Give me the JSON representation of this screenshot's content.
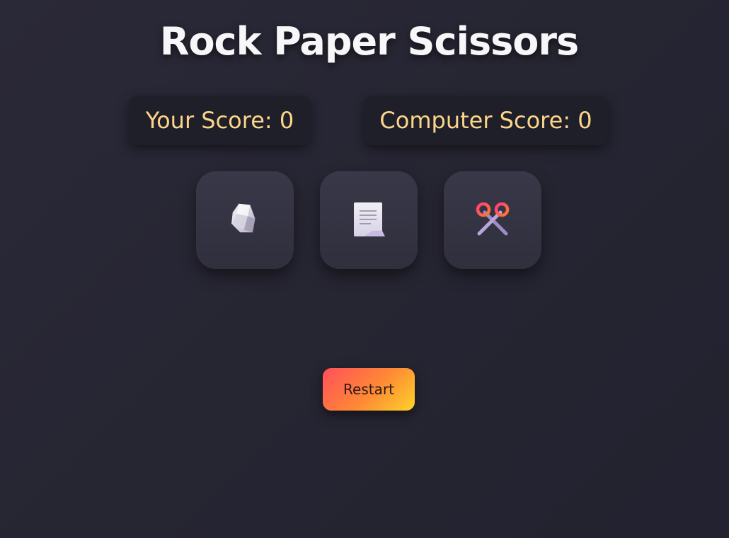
{
  "game": {
    "title": "Rock Paper Scissors"
  },
  "scores": {
    "player_label": "Your Score: 0",
    "player_value": 0,
    "computer_label": "Computer Score: 0",
    "computer_value": 0
  },
  "choices": [
    {
      "id": "rock",
      "icon": "rock-icon"
    },
    {
      "id": "paper",
      "icon": "paper-icon"
    },
    {
      "id": "scissors",
      "icon": "scissors-icon"
    }
  ],
  "controls": {
    "restart_label": "Restart"
  },
  "colors": {
    "background": "#262532",
    "title": "#f7f7f9",
    "score_text": "#fcd58a",
    "score_box": "#1f1f29",
    "choice_box": "#353444",
    "restart_gradient_start": "#ff4f5a",
    "restart_gradient_end": "#fcd32a"
  }
}
